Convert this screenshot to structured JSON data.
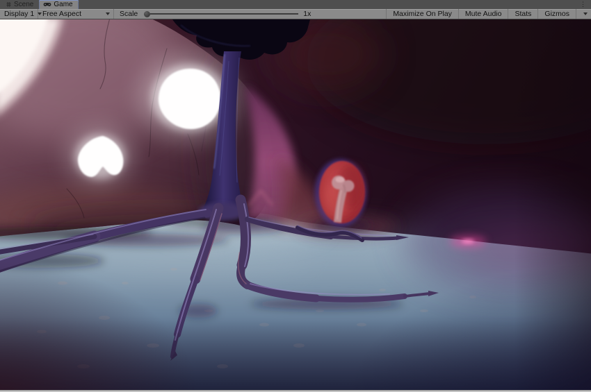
{
  "window": {
    "tabs": [
      {
        "label": "Scene",
        "icon": "grid-icon",
        "active": false
      },
      {
        "label": "Game",
        "icon": "gamepad-icon",
        "active": true
      }
    ],
    "overflow_menu": "⋮"
  },
  "toolbar": {
    "display_dropdown": {
      "value": "Display 1"
    },
    "aspect_dropdown": {
      "value": "Free Aspect"
    },
    "scale": {
      "label": "Scale",
      "value": "1x",
      "slider_position": "min"
    },
    "buttons": [
      {
        "label": "Maximize On Play"
      },
      {
        "label": "Mute Audio"
      },
      {
        "label": "Stats"
      },
      {
        "label": "Gizmos",
        "has_dropdown": true
      }
    ]
  },
  "icons": {
    "kebab_menu": "⋮",
    "dropdown_caret": "css-triangle-down",
    "scene_tab": "grid",
    "game_tab": "gamepad"
  },
  "viewport": {
    "type": "3d-game-render",
    "scene_objects": [
      {
        "name": "skull-rock-wall",
        "description": "large mauve cave wall shaped like a skull with two glowing openings",
        "base_color": "#6b4453"
      },
      {
        "name": "light-opening-top-left",
        "color": "#f8eeec"
      },
      {
        "name": "eye-socket-glow-large",
        "color": "#ffffff"
      },
      {
        "name": "eye-socket-glow-heart",
        "color": "#ffffff"
      },
      {
        "name": "alien-tree",
        "trunk_color": "#3f3270",
        "canopy_color": "#0a0613",
        "root_color": "#46355f",
        "highlight_color": "#9a8cc8"
      },
      {
        "name": "red-portal",
        "fill_color": "#a73138",
        "rim_color": "#473379"
      },
      {
        "name": "bone",
        "color": "#c08d93"
      },
      {
        "name": "cave-floor",
        "near_color": "#a9bac6",
        "far_color": "#2e3854"
      },
      {
        "name": "pink-floor-glow",
        "color": "#ff4da6"
      },
      {
        "name": "magenta-wall-gap",
        "color": "#9c4e7c"
      },
      {
        "name": "background-wall",
        "left_color": "#44202c",
        "right_color": "#1a0814",
        "purple_haze": "#4a3468"
      }
    ]
  }
}
